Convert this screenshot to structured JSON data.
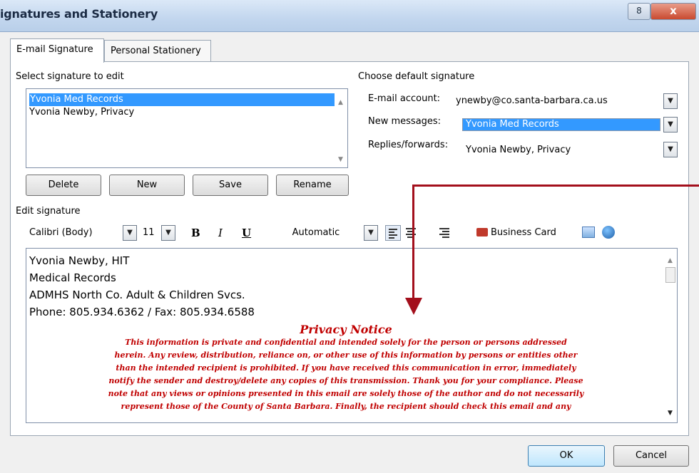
{
  "window": {
    "title": "ignatures and Stationery",
    "minimize_glyph": "8",
    "close_glyph": "x"
  },
  "tabs": [
    {
      "label": "E-mail Signature",
      "active": true
    },
    {
      "label": "Personal Stationery",
      "active": false
    }
  ],
  "select_signature": {
    "label": "Select signature to edit",
    "items": [
      {
        "label": "Yvonia Med Records",
        "selected": true
      },
      {
        "label": "Yvonia Newby, Privacy",
        "selected": false
      }
    ]
  },
  "buttons": {
    "delete": "Delete",
    "new": "New",
    "save": "Save",
    "rename": "Rename"
  },
  "default_signature": {
    "label": "Choose default signature",
    "email_account_label": "E-mail account:",
    "email_account_value": "ynewby@co.santa-barbara.ca.us",
    "new_messages_label": "New messages:",
    "new_messages_value": "Yvonia Med Records",
    "replies_label": "Replies/forwards:",
    "replies_value": "Yvonia Newby, Privacy"
  },
  "edit_signature": {
    "label": "Edit signature",
    "font": "Calibri (Body)",
    "size": "11",
    "bold": "B",
    "italic": "I",
    "underline": "U",
    "color": "Automatic",
    "business_card": "Business Card"
  },
  "signature_body": {
    "lines": [
      "Yvonia Newby, HIT",
      "Medical Records",
      "ADMHS North Co. Adult & Children Svcs.",
      "Phone: 805.934.6362 / Fax: 805.934.6588"
    ],
    "notice_title": "Privacy Notice",
    "notice_lines": [
      "This information is private and confidential and intended solely for the person or persons addressed",
      "herein.  Any review, distribution, reliance on, or other use of this information by persons or entities other",
      "than the intended recipient is prohibited.  If you have received this communication in error, immediately",
      "notify the sender and destroy/delete any copies of this transmission.  Thank you for your compliance.  Please",
      "note that any views or opinions presented in this email are solely those of the author and do not necessarily",
      "represent those of the County of Santa Barbara.  Finally, the recipient should check this email and any"
    ]
  },
  "footer": {
    "ok": "OK",
    "cancel": "Cancel"
  },
  "colors": {
    "selection": "#3399ff",
    "notice_red": "#c00000",
    "arrow": "#a30f1c"
  },
  "icons": [
    "align-left-icon",
    "align-center-icon",
    "align-right-icon",
    "business-card-icon",
    "insert-picture-icon",
    "insert-hyperlink-icon"
  ]
}
